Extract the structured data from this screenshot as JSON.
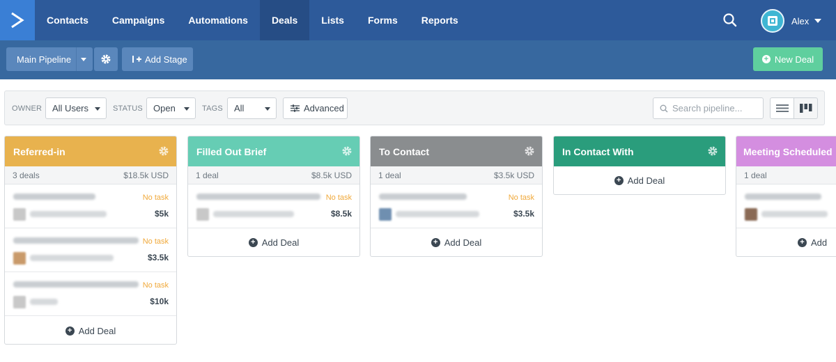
{
  "nav": {
    "items": [
      {
        "label": "Contacts"
      },
      {
        "label": "Campaigns"
      },
      {
        "label": "Automations"
      },
      {
        "label": "Deals",
        "active": true
      },
      {
        "label": "Lists"
      },
      {
        "label": "Forms"
      },
      {
        "label": "Reports"
      }
    ],
    "user_name": "Alex"
  },
  "toolbar": {
    "pipeline_label": "Main Pipeline",
    "add_stage_label": "Add Stage",
    "new_deal_label": "New Deal"
  },
  "filters": {
    "owner_label": "OWNER",
    "owner_value": "All Users",
    "status_label": "STATUS",
    "status_value": "Open",
    "tags_label": "TAGS",
    "tags_value": "All",
    "advanced_label": "Advanced",
    "search_placeholder": "Search pipeline..."
  },
  "stages": [
    {
      "name": "Referred-in",
      "color": "#e8b24e",
      "count": "3 deals",
      "total": "$18.5k USD",
      "deals": [
        {
          "status": "No task",
          "amount": "$5k"
        },
        {
          "status": "No task",
          "amount": "$3.5k"
        },
        {
          "status": "No task",
          "amount": "$10k"
        }
      ],
      "add_label": "Add Deal"
    },
    {
      "name": "Filled Out Brief",
      "color": "#66cdb4",
      "count": "1 deal",
      "total": "$8.5k USD",
      "deals": [
        {
          "status": "No task",
          "amount": "$8.5k"
        }
      ],
      "add_label": "Add Deal"
    },
    {
      "name": "To Contact",
      "color": "#8a8d8f",
      "count": "1 deal",
      "total": "$3.5k USD",
      "deals": [
        {
          "status": "No task",
          "amount": "$3.5k"
        }
      ],
      "add_label": "Add Deal"
    },
    {
      "name": "In Contact With",
      "color": "#2a9d7c",
      "add_label": "Add Deal"
    },
    {
      "name": "Meeting Scheduled",
      "color": "#d48ee0",
      "count": "1 deal",
      "add_label": "Add"
    }
  ]
}
